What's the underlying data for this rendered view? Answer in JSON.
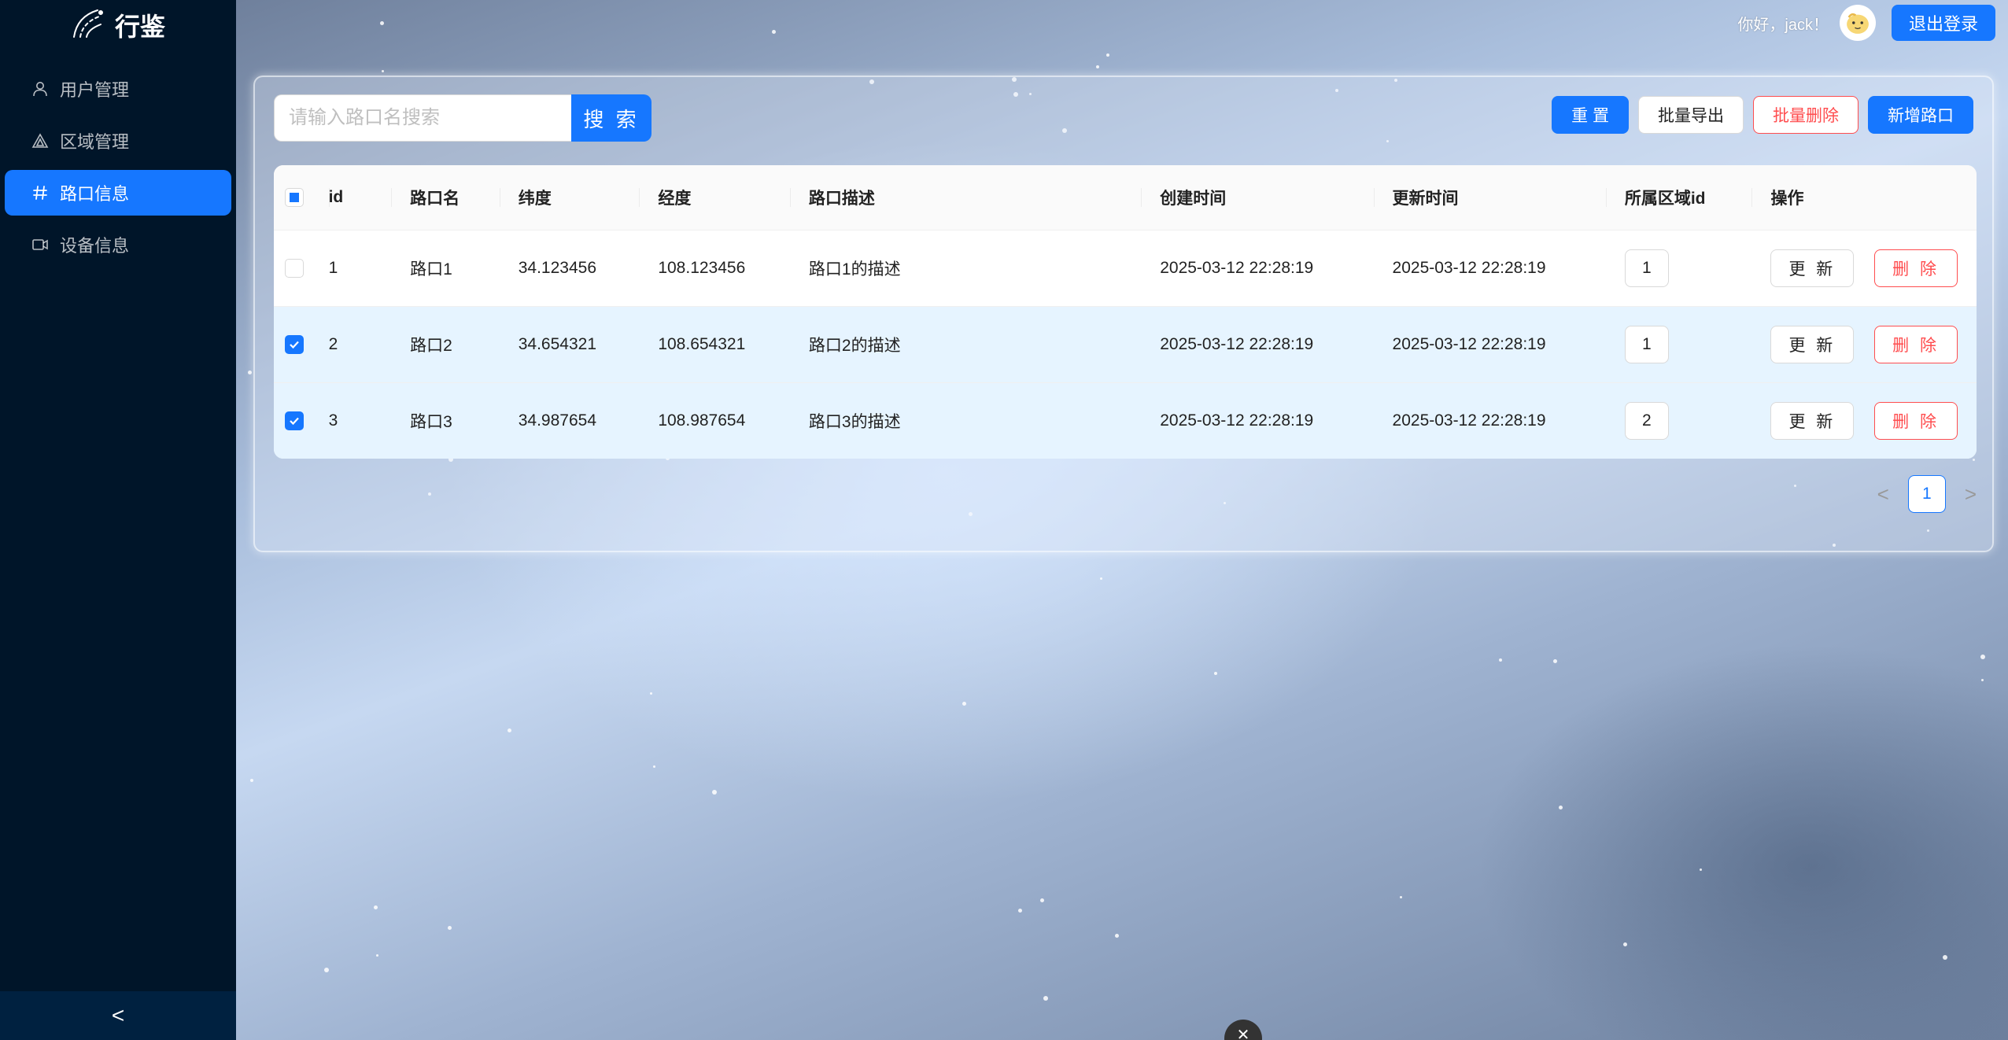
{
  "app": {
    "title": "行鉴"
  },
  "sidebar": {
    "items": [
      {
        "label": "用户管理",
        "icon": "user-icon",
        "active": false
      },
      {
        "label": "区域管理",
        "icon": "region-icon",
        "active": false
      },
      {
        "label": "路口信息",
        "icon": "hash-icon",
        "active": true
      },
      {
        "label": "设备信息",
        "icon": "video-camera-icon",
        "active": false
      }
    ],
    "collapse_label": "<"
  },
  "header": {
    "greeting": "你好，jack！",
    "logout_label": "退出登录"
  },
  "search": {
    "placeholder": "请输入路口名搜索",
    "value": "",
    "button_label": "搜 索"
  },
  "toolbar": {
    "reset_label": "重 置",
    "export_label": "批量导出",
    "batch_delete_label": "批量删除",
    "add_label": "新增路口"
  },
  "table": {
    "columns": [
      "id",
      "路口名",
      "纬度",
      "经度",
      "路口描述",
      "创建时间",
      "更新时间",
      "所属区域id",
      "操作"
    ],
    "rows": [
      {
        "checked": false,
        "id": "1",
        "name": "路口1",
        "lat": "34.123456",
        "lng": "108.123456",
        "desc": "路口1的描述",
        "created": "2025-03-12 22:28:19",
        "updated": "2025-03-12 22:28:19",
        "region_id": "1"
      },
      {
        "checked": true,
        "id": "2",
        "name": "路口2",
        "lat": "34.654321",
        "lng": "108.654321",
        "desc": "路口2的描述",
        "created": "2025-03-12 22:28:19",
        "updated": "2025-03-12 22:28:19",
        "region_id": "1"
      },
      {
        "checked": true,
        "id": "3",
        "name": "路口3",
        "lat": "34.987654",
        "lng": "108.987654",
        "desc": "路口3的描述",
        "created": "2025-03-12 22:28:19",
        "updated": "2025-03-12 22:28:19",
        "region_id": "2"
      }
    ],
    "update_label": "更 新",
    "delete_label": "删 除"
  },
  "pagination": {
    "current_page": "1",
    "prev": "<",
    "next": ">"
  },
  "colors": {
    "primary": "#1677ff",
    "danger": "#ff4d4f",
    "sidebar": "#001529"
  }
}
